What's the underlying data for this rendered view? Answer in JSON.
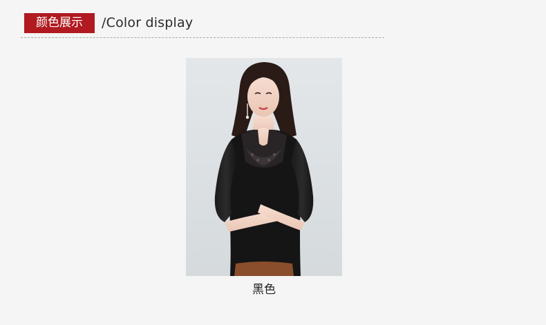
{
  "header": {
    "badge_label": "颜色展示",
    "subtitle": "/Color display",
    "badge_color": "#b01a20"
  },
  "product": {
    "color_name": "黑色"
  }
}
